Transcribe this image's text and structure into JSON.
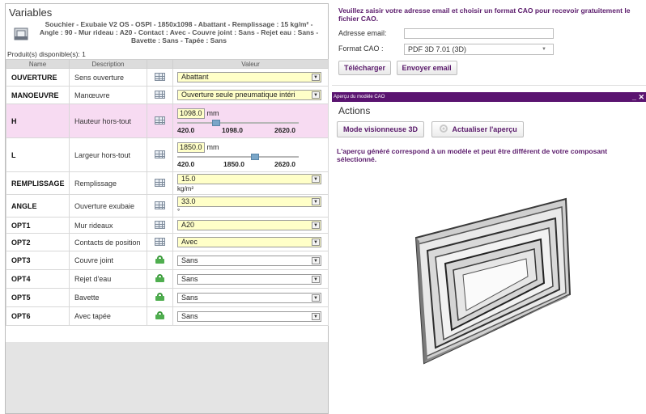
{
  "variables_panel": {
    "title": "Variables",
    "product_description": "Souchier - Exubaie V2 OS - OSPI - 1850x1098 - Abattant - Remplissage : 15 kg/m² - Angle : 90 - Mur rideau : A20 - Contact : Avec - Couvre joint : Sans - Rejet eau : Sans - Bavette : Sans - Tapée : Sans",
    "available_label": "Produit(s) disponible(s): 1",
    "columns": {
      "name": "Name",
      "description": "Description",
      "value": "Valeur"
    },
    "rows": [
      {
        "name": "OUVERTURE",
        "description": "Sens ouverture",
        "icon": "grid-icon",
        "value": "Abattant"
      },
      {
        "name": "MANOEUVRE",
        "description": "Manœuvre",
        "icon": "grid-icon",
        "value": "Ouverture seule pneumatique intéri"
      },
      {
        "name": "H",
        "description": "Hauteur hors-tout",
        "icon": "grid-icon",
        "value": "1098.0",
        "unit": "mm",
        "min": "420.0",
        "current": "1098.0",
        "max": "2620.0",
        "fraction": 0.31
      },
      {
        "name": "L",
        "description": "Largeur hors-tout",
        "icon": "grid-icon",
        "value": "1850.0",
        "unit": "mm",
        "min": "420.0",
        "current": "1850.0",
        "max": "2620.0",
        "fraction": 0.65
      },
      {
        "name": "REMPLISSAGE",
        "description": "Remplissage",
        "icon": "grid-icon",
        "value": "15.0",
        "unit": "kg/m²"
      },
      {
        "name": "ANGLE",
        "description": "Ouverture exubaie",
        "icon": "grid-icon",
        "value": "33.0",
        "unit": "°"
      },
      {
        "name": "OPT1",
        "description": "Mur rideaux",
        "icon": "grid-icon",
        "value": "A20"
      },
      {
        "name": "OPT2",
        "description": "Contacts de position",
        "icon": "grid-icon",
        "value": "Avec"
      },
      {
        "name": "OPT3",
        "description": "Couvre joint",
        "icon": "lock-icon",
        "value": "Sans"
      },
      {
        "name": "OPT4",
        "description": "Rejet d'eau",
        "icon": "lock-icon",
        "value": "Sans"
      },
      {
        "name": "OPT5",
        "description": "Bavette",
        "icon": "lock-icon",
        "value": "Sans"
      },
      {
        "name": "OPT6",
        "description": "Avec tapée",
        "icon": "lock-icon",
        "value": "Sans"
      }
    ]
  },
  "cao": {
    "intro": "Veuillez saisir votre adresse email et choisir un format CAO pour recevoir gratuitement le fichier CAO.",
    "email_label": "Adresse email:",
    "email_value": "",
    "format_label": "Format CAO :",
    "format_value": "PDF 3D 7.01 (3D)",
    "download_button": "Télécharger",
    "send_button": "Envoyer email"
  },
  "preview": {
    "bar_title": "Aperçu du modèle CAO",
    "bar_controls": "_ ✕",
    "actions_title": "Actions",
    "viewer_button": "Mode visionneuse 3D",
    "refresh_button": "Actualiser l'aperçu",
    "note": "L'aperçu généré correspond à un modèle et peut être différent de votre composant sélectionné."
  },
  "colors": {
    "accent": "#5a1470",
    "highlight_row": "#f7dbf2",
    "input_yellow": "#ffffc8"
  }
}
